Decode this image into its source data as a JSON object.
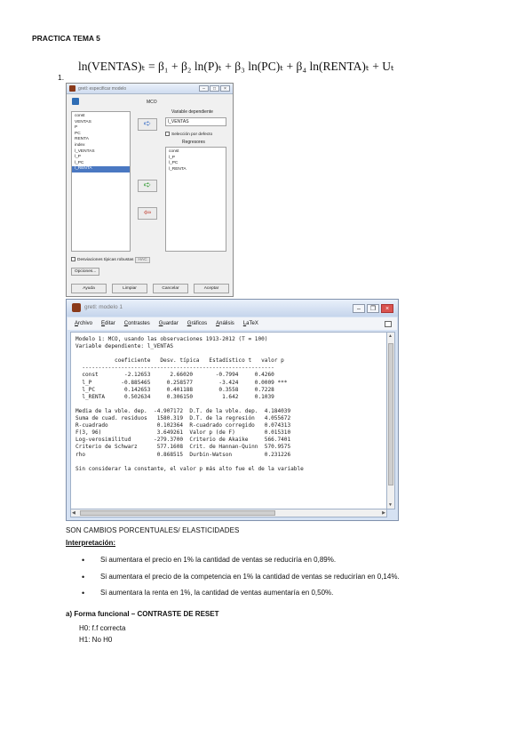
{
  "document": {
    "title": "PRACTICA TEMA 5",
    "item_number": "1.",
    "formula": "ln(VENTAS)ₜ = β₁ + β₂ ln(P)ₜ + β₃ ln(PC)ₜ + β₄ ln(RENTA)ₜ + Uₜ"
  },
  "dialog": {
    "title": "gretl: especificar modelo",
    "method": "MCO",
    "variables": [
      "const",
      "VENTAS",
      "P",
      "PC",
      "RENTA",
      "index",
      "l_VENTAS",
      "l_P",
      "l_PC",
      "l_RENTA"
    ],
    "selected_variable": "l_RENTA",
    "dependent_label": "Variable dependiente",
    "dependent_value": "l_VENTAS",
    "default_selection": "Selección por defecto",
    "regressors_label": "Regresores",
    "regressors": [
      "const",
      "l_P",
      "l_PC",
      "l_RENTA"
    ],
    "robust_label": "Desviaciones típicas robustas",
    "robust_config": "HAC",
    "options_button": "Opciones...",
    "buttons": [
      "Ayuda",
      "Limpiar",
      "Cancelar",
      "Aceptar"
    ]
  },
  "output": {
    "title": "gretl: modelo 1",
    "menu": [
      "Archivo",
      "Editar",
      "Contrastes",
      "Guardar",
      "Gráficos",
      "Análisis",
      "LaTeX"
    ],
    "model_line": "Modelo 1: MCO, usando las observaciones 1913-2012 (T = 100)",
    "dependent_line": "Variable dependiente: l_VENTAS",
    "headers": [
      "coeficiente",
      "Desv. típica",
      "Estadístico t",
      "valor p"
    ],
    "coefficients": [
      {
        "name": "const",
        "coef": "-2.12653",
        "se": "2.66020",
        "t": "-0.7994",
        "p": "0.4260",
        "stars": ""
      },
      {
        "name": "l_P",
        "coef": "-0.885465",
        "se": "0.258577",
        "t": "-3.424",
        "p": "0.0009",
        "stars": "***"
      },
      {
        "name": "l_PC",
        "coef": "0.142653",
        "se": "0.401188",
        "t": "0.3558",
        "p": "0.7228",
        "stars": ""
      },
      {
        "name": "l_RENTA",
        "coef": "0.502634",
        "se": "0.306150",
        "t": "1.642",
        "p": "0.1039",
        "stars": ""
      }
    ],
    "stats": [
      {
        "l1": "Media de la vble. dep.",
        "v1": "-4.907172",
        "l2": "D.T. de la vble. dep.",
        "v2": "4.184039"
      },
      {
        "l1": "Suma de cuad. residuos",
        "v1": "1580.319",
        "l2": "D.T. de la regresión",
        "v2": "4.055672"
      },
      {
        "l1": "R-cuadrado",
        "v1": "0.102364",
        "l2": "R-cuadrado corregido",
        "v2": "0.074313"
      },
      {
        "l1": "F(3, 96)",
        "v1": "3.649261",
        "l2": "Valor p (de F)",
        "v2": "0.015310"
      },
      {
        "l1": "Log-verosimilitud",
        "v1": "-279.3700",
        "l2": "Criterio de Akaike",
        "v2": "566.7401"
      },
      {
        "l1": "Criterio de Schwarz",
        "v1": "577.1608",
        "l2": "Crit. de Hannan-Quinn",
        "v2": "570.9575"
      },
      {
        "l1": "rho",
        "v1": "0.868515",
        "l2": "Durbin-Watson",
        "v2": "0.231226"
      }
    ],
    "footer": "Sin considerar la constante, el valor p más alto fue el de la variable"
  },
  "caption": "SON CAMBIOS PORCENTUALES/ ELASTICIDADES",
  "interpretation_heading": "Interpretación:",
  "interpretations": [
    "Si aumentara el precio en 1% la cantidad de ventas se reduciría en 0,89%.",
    "Si aumentara el precio de la competencia en 1% la cantidad de ventas se reducirían en 0,14%.",
    "Si aumentara la renta en 1%, la cantidad de ventas aumentaría en 0,50%."
  ],
  "section_a": {
    "heading": "a)   Forma funcional – CONTRASTE DE RESET",
    "h0": "H0: f.f correcta",
    "h1": "H1: No H0"
  }
}
